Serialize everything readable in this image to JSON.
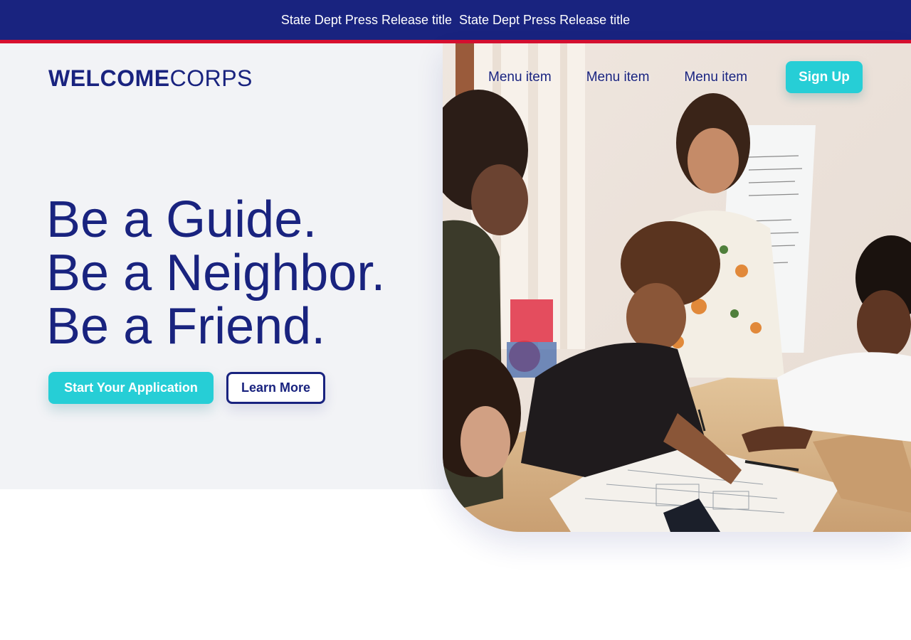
{
  "announcement": {
    "messages": [
      "State Dept Press Release title",
      "State Dept Press Release title"
    ]
  },
  "logo": {
    "bold": "WELCOME",
    "light": "CORPS"
  },
  "nav": {
    "items": [
      "Menu item",
      "Menu item",
      "Menu item"
    ],
    "signup_label": "Sign Up"
  },
  "hero": {
    "headline_lines": [
      "Be a Guide.",
      "Be a Neighbor.",
      "Be a Friend."
    ],
    "primary_cta": "Start Your Application",
    "secondary_cta": "Learn More",
    "image_icon": "hero-photo-people-collaborating"
  },
  "colors": {
    "navy": "#19237f",
    "red": "#d8102f",
    "teal": "#26ced6",
    "hero_bg": "#f2f3f6"
  }
}
